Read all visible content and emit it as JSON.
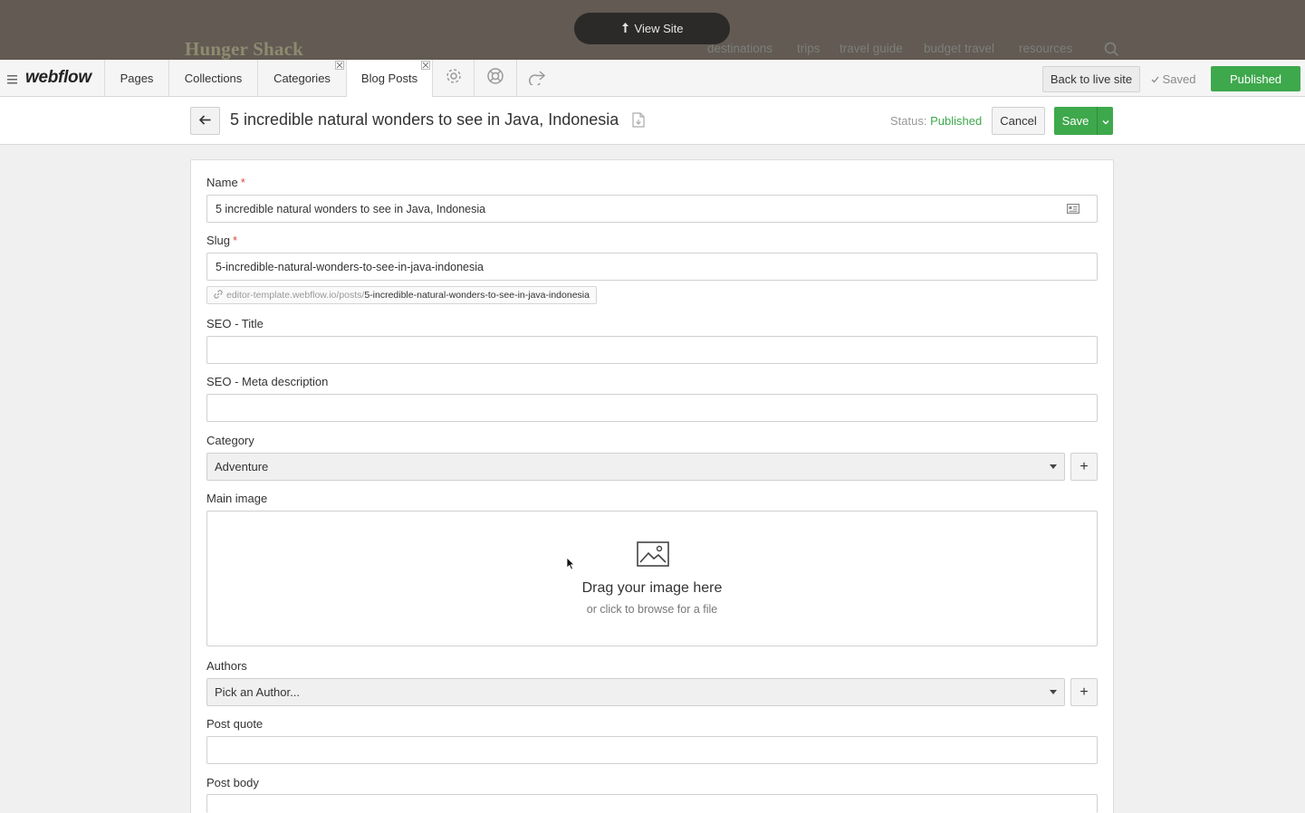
{
  "site_preview": {
    "logo": "Hunger Shack",
    "nav": [
      "destinations",
      "trips",
      "travel guide",
      "budget travel",
      "resources"
    ],
    "view_site_label": "View Site"
  },
  "editor_bar": {
    "brand": "webflow",
    "tabs": [
      {
        "label": "Pages",
        "active": false
      },
      {
        "label": "Collections",
        "active": false
      },
      {
        "label": "Categories",
        "active": false,
        "closable": true
      },
      {
        "label": "Blog Posts",
        "active": true,
        "closable": true
      }
    ],
    "icon_tabs": [
      "gear-icon",
      "help-icon",
      "share-icon"
    ],
    "back_to_live_label": "Back to live site",
    "saved_label": "Saved",
    "published_label": "Published"
  },
  "item_header": {
    "title": "5 incredible natural wonders to see in Java, Indonesia",
    "status_label": "Status:",
    "status_value": "Published",
    "cancel_label": "Cancel",
    "save_label": "Save"
  },
  "form": {
    "name": {
      "label": "Name",
      "required": "*",
      "value": "5 incredible natural wonders to see in Java, Indonesia"
    },
    "slug": {
      "label": "Slug",
      "required": "*",
      "value": "5-incredible-natural-wonders-to-see-in-java-indonesia"
    },
    "url_preview": {
      "base": "editor-template.webflow.io/posts/",
      "slug": "5-incredible-natural-wonders-to-see-in-java-indonesia"
    },
    "seo_title": {
      "label": "SEO - Title",
      "value": ""
    },
    "seo_meta": {
      "label": "SEO - Meta description",
      "value": ""
    },
    "category": {
      "label": "Category",
      "value": "Adventure",
      "add": "+"
    },
    "main_image": {
      "label": "Main image",
      "drop_main": "Drag your image here",
      "drop_sub": "or click to browse for a file"
    },
    "authors": {
      "label": "Authors",
      "value": "Pick an Author...",
      "add": "+"
    },
    "post_quote": {
      "label": "Post quote",
      "value": ""
    },
    "post_body": {
      "label": "Post body"
    }
  },
  "colors": {
    "accent_green": "#3ea84c",
    "site_bar": "#625a53",
    "required_red": "#e04848"
  }
}
